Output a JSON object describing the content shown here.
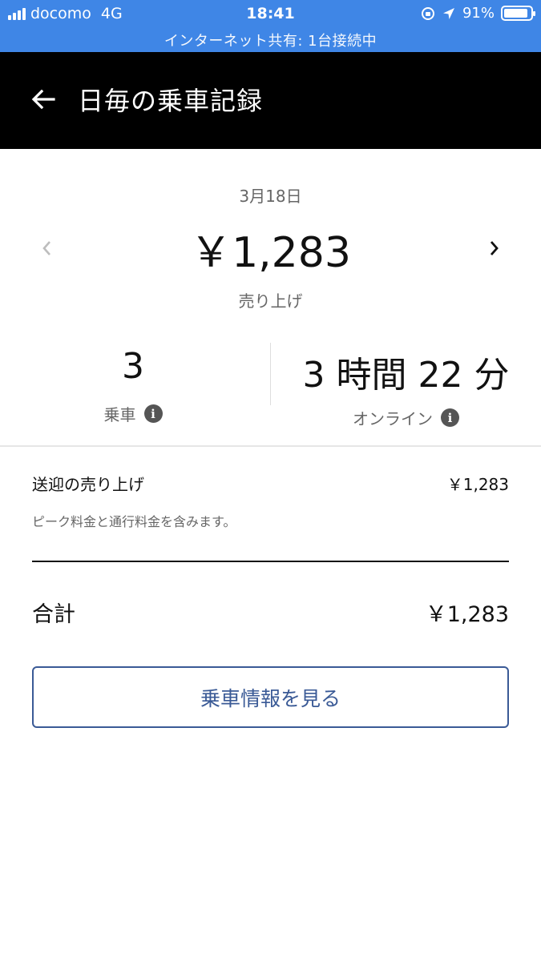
{
  "status_bar": {
    "carrier": "docomo",
    "network": "4G",
    "time": "18:41",
    "battery": "91%",
    "battery_level": 0.91,
    "hotspot_text": "インターネット共有: 1台接続中",
    "background_color": "#3f86e6"
  },
  "app_bar": {
    "back_icon": "arrow-left-icon",
    "title": "日毎の乗車記録"
  },
  "summary": {
    "date": "3月18日",
    "prev_icon": "chevron-left-icon",
    "next_icon": "chevron-right-icon",
    "amount": "￥1,283",
    "amount_label": "売り上げ"
  },
  "stats": {
    "rides_value": "3",
    "rides_label": "乗車",
    "online_value": "3 時間 22 分",
    "online_label": "オンライン",
    "info_icon": "i"
  },
  "breakdown": {
    "item_label": "送迎の売り上げ",
    "item_value": "￥1,283",
    "note": "ピーク料金と通行料金を含みます。",
    "total_label": "合計",
    "total_value": "￥1,283"
  },
  "actions": {
    "view_trips_label": "乗車情報を見る",
    "accent_color": "#3a5a96"
  }
}
